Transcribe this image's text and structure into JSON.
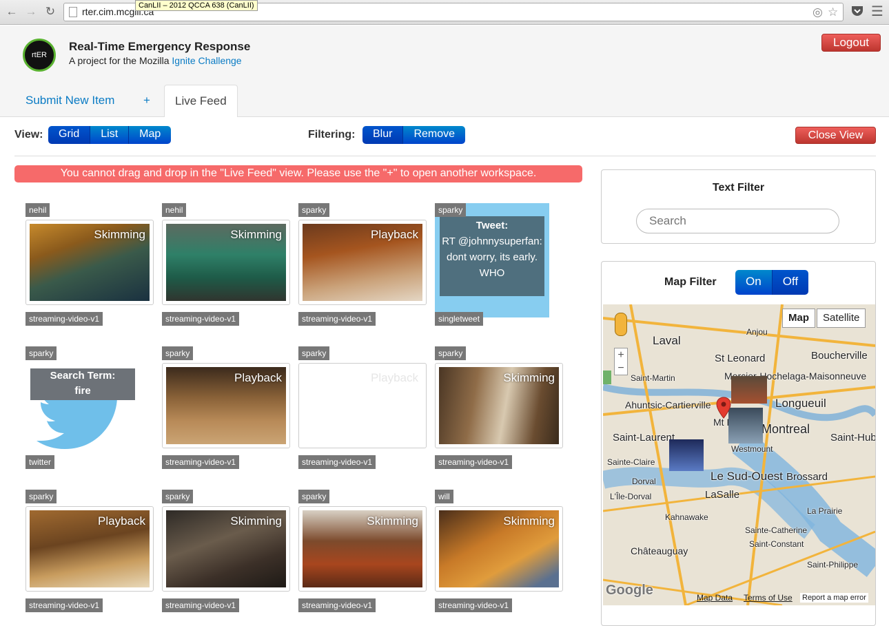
{
  "browser": {
    "url": "rter.cim.mcgill.ca",
    "tooltip": "CanLII – 2012 QCCA 638 (CanLII)"
  },
  "header": {
    "logo_text": "rtER",
    "title": "Real-Time Emergency Response",
    "subtitle_prefix": "A project for the Mozilla ",
    "subtitle_link": "Ignite Challenge",
    "logout_label": "Logout"
  },
  "tabs": {
    "submit": "Submit New Item",
    "plus": "+",
    "live": "Live Feed"
  },
  "toolbar": {
    "view_label": "View:",
    "view_options": [
      "Grid",
      "List",
      "Map"
    ],
    "filter_label": "Filtering:",
    "filter_options": [
      "Blur",
      "Remove"
    ],
    "close_label": "Close View"
  },
  "alert": "You cannot drag and drop in the \"Live Feed\" view. Please use the \"+\" to open another workspace.",
  "grid": [
    {
      "user": "nehil",
      "type": "streaming-video-v1",
      "label": "Skimming"
    },
    {
      "user": "nehil",
      "type": "streaming-video-v1",
      "label": "Skimming"
    },
    {
      "user": "sparky",
      "type": "streaming-video-v1",
      "label": "Playback"
    },
    {
      "user": "sparky",
      "type": "singletweet",
      "tweet_title": "Tweet:",
      "tweet_body": "RT @johnnysuperfan: dont worry, its early. WHO"
    },
    {
      "user": "sparky",
      "type": "twitter",
      "search_title": "Search Term:",
      "search_term": "fire"
    },
    {
      "user": "sparky",
      "type": "streaming-video-v1",
      "label": "Playback"
    },
    {
      "user": "sparky",
      "type": "streaming-video-v1",
      "label": "Playback"
    },
    {
      "user": "sparky",
      "type": "streaming-video-v1",
      "label": "Skimming"
    },
    {
      "user": "sparky",
      "type": "streaming-video-v1",
      "label": "Playback"
    },
    {
      "user": "sparky",
      "type": "streaming-video-v1",
      "label": "Skimming"
    },
    {
      "user": "sparky",
      "type": "streaming-video-v1",
      "label": "Skimming"
    },
    {
      "user": "will",
      "type": "streaming-video-v1",
      "label": "Skimming"
    }
  ],
  "text_filter": {
    "title": "Text Filter",
    "placeholder": "Search"
  },
  "map_filter": {
    "title": "Map Filter",
    "on": "On",
    "off": "Off",
    "map_btn": "Map",
    "satellite_btn": "Satellite",
    "places": [
      "Laval",
      "Anjou",
      "St Leonard",
      "Boucherville",
      "Saint-Martin",
      "Mercier-Hochelaga-Maisonneuve",
      "Ahuntsic-Cartierville",
      "Longueuil",
      "Mt Royal",
      "Saint-Laurent",
      "Montreal",
      "Saint-Hubert",
      "Westmount",
      "Le Sud-Ouest",
      "Brossard",
      "Dorval",
      "LaSalle",
      "L'Île-Dorval",
      "Kahnawake",
      "La Prairie",
      "Sainte-Catherine",
      "Saint-Constant",
      "Châteauguay",
      "Saint-Philippe",
      "Sainte-Claire"
    ],
    "footer_data": "Map Data",
    "footer_terms": "Terms of Use",
    "footer_report": "Report a map error",
    "google": "Google"
  },
  "colors": {
    "primary": "#0055cc",
    "danger": "#d9423b",
    "alert": "#f66a6a",
    "tweet": "#87cdf0"
  }
}
